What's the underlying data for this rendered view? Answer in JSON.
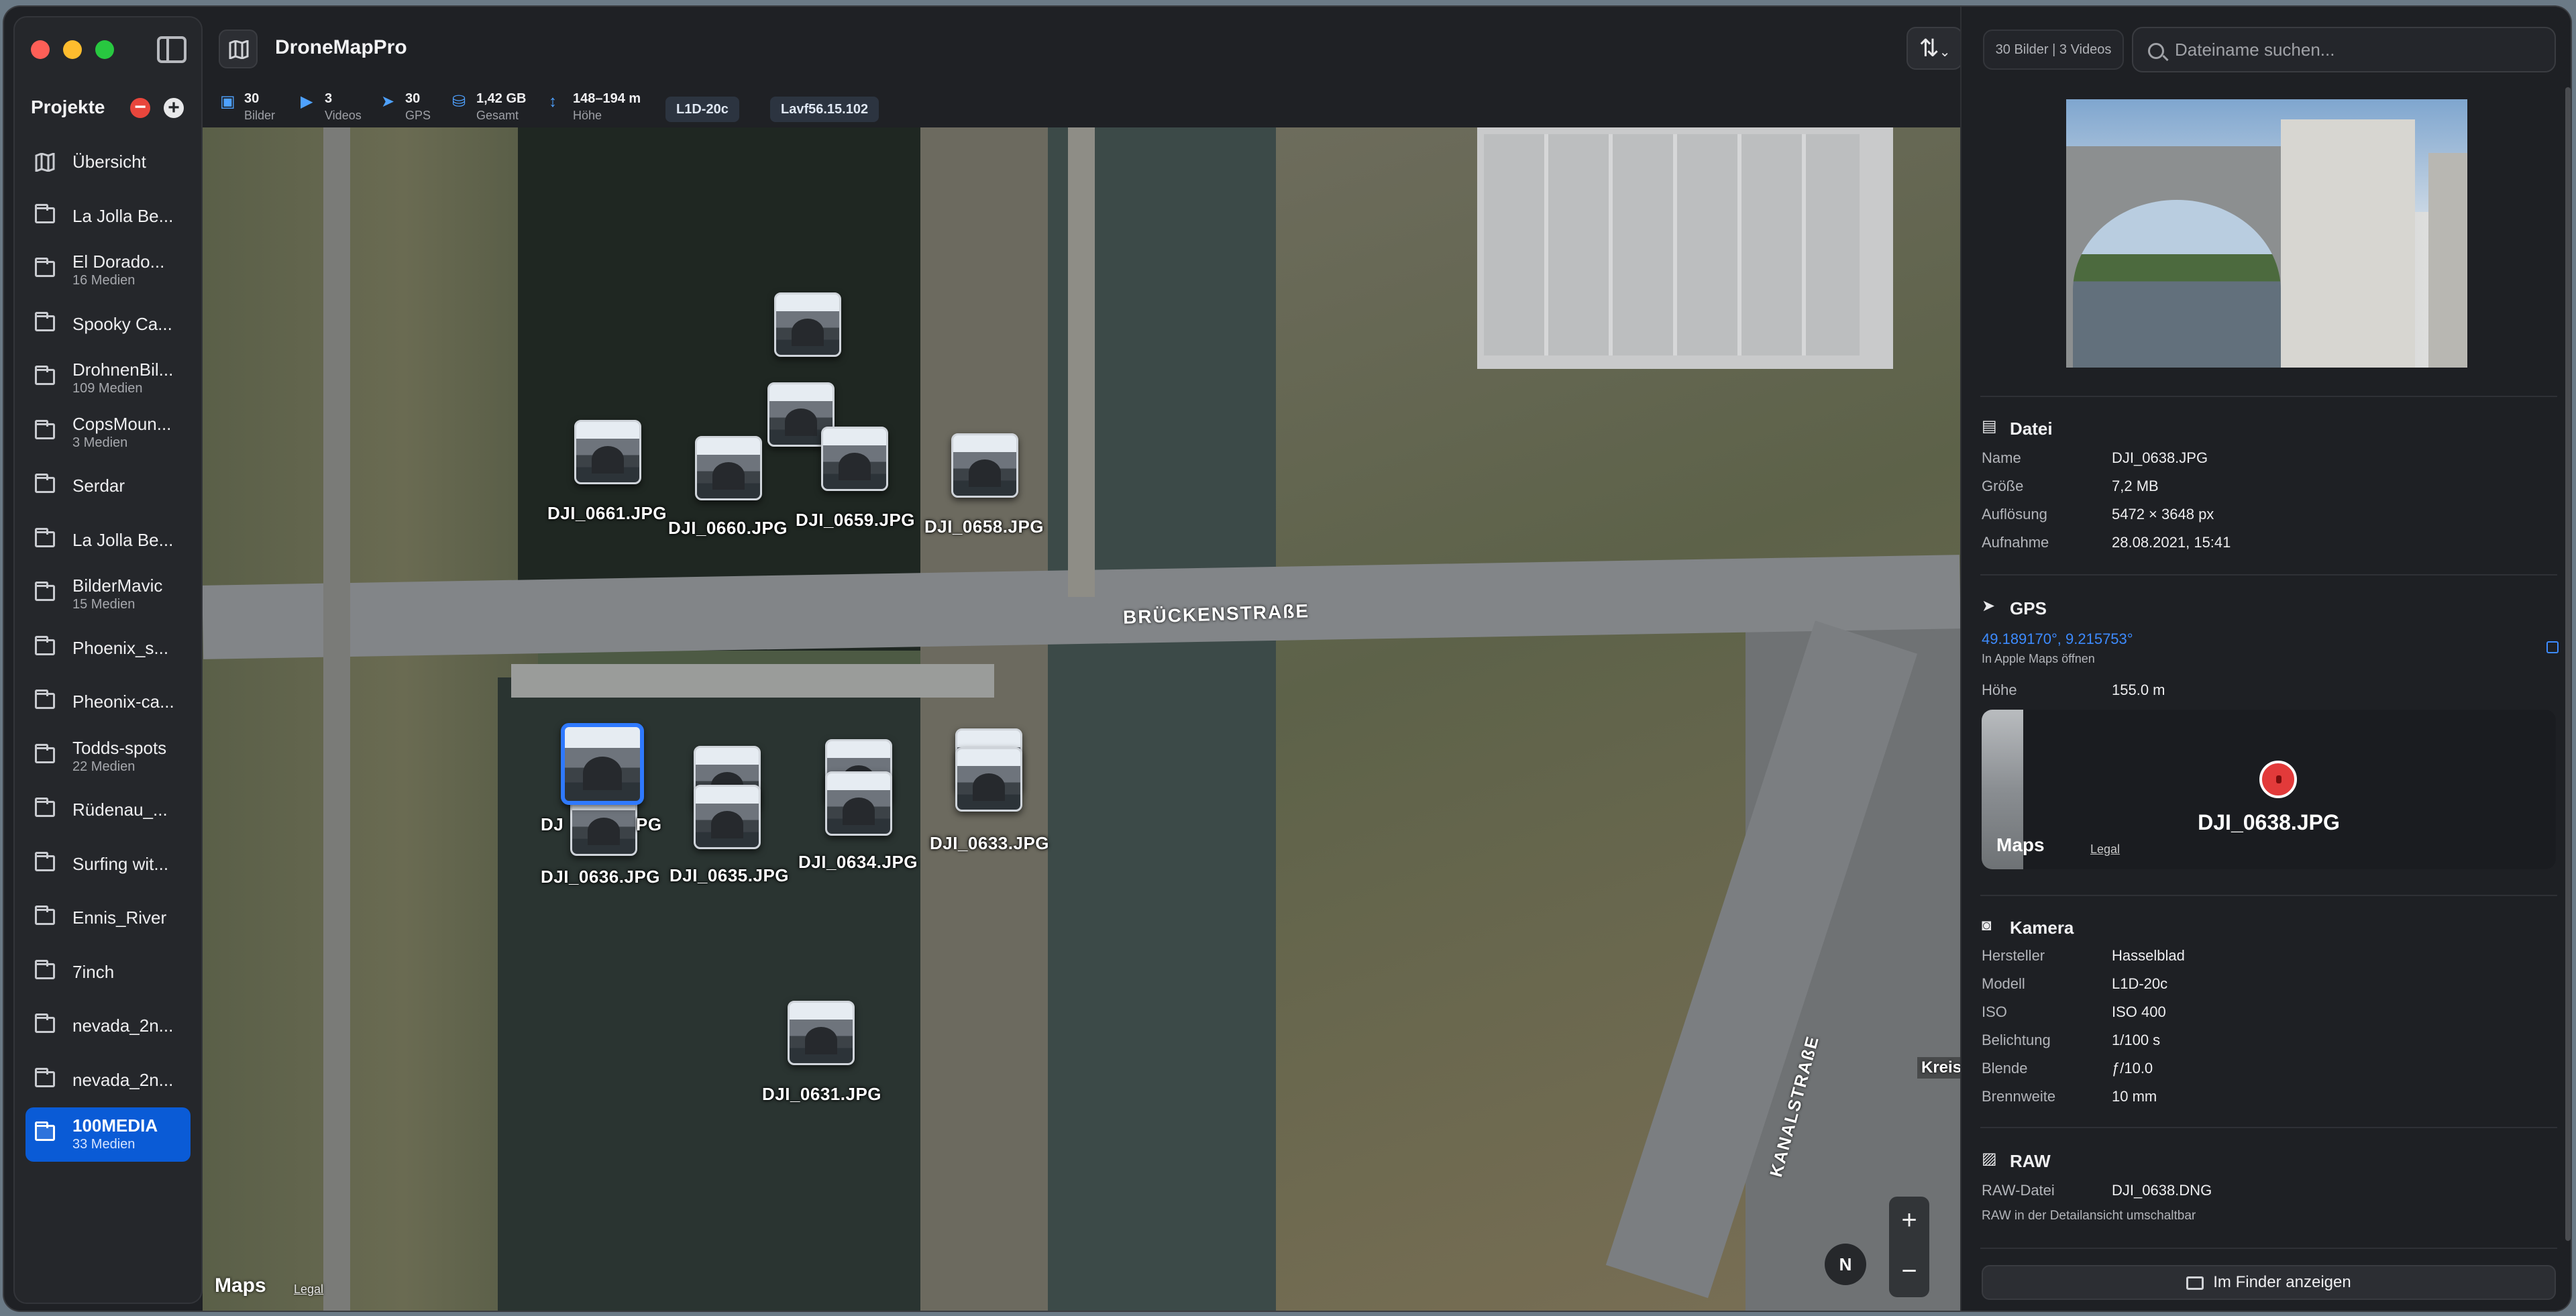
{
  "app": {
    "title": "DroneMapPro"
  },
  "sidebar": {
    "header": "Projekte",
    "items": [
      {
        "name": "Übersicht",
        "sub": "",
        "icon": "map-icon"
      },
      {
        "name": "La Jolla Be...",
        "sub": ""
      },
      {
        "name": "El Dorado...",
        "sub": "16 Medien"
      },
      {
        "name": "Spooky Ca...",
        "sub": ""
      },
      {
        "name": "DrohnenBil...",
        "sub": "109 Medien"
      },
      {
        "name": "CopsMoun...",
        "sub": "3 Medien"
      },
      {
        "name": "Serdar",
        "sub": ""
      },
      {
        "name": "La Jolla Be...",
        "sub": ""
      },
      {
        "name": "BilderMavic",
        "sub": "15 Medien"
      },
      {
        "name": "Phoenix_s...",
        "sub": ""
      },
      {
        "name": "Pheonix-ca...",
        "sub": ""
      },
      {
        "name": "Todds-spots",
        "sub": "22 Medien"
      },
      {
        "name": "Rüdenau_...",
        "sub": ""
      },
      {
        "name": "Surfing wit...",
        "sub": ""
      },
      {
        "name": "Ennis_River",
        "sub": ""
      },
      {
        "name": "7inch",
        "sub": ""
      },
      {
        "name": "nevada_2n...",
        "sub": ""
      },
      {
        "name": "nevada_2n...",
        "sub": ""
      },
      {
        "name": "100MEDIA",
        "sub": "33 Medien",
        "selected": true
      }
    ]
  },
  "stats": {
    "images": {
      "value": "30",
      "label": "Bilder"
    },
    "videos": {
      "value": "3",
      "label": "Videos"
    },
    "gps": {
      "value": "30",
      "label": "GPS"
    },
    "total": {
      "value": "1,42 GB",
      "label": "Gesamt"
    },
    "height": {
      "value": "148–194 m",
      "label": "Höhe"
    },
    "chip1": "L1D-20c",
    "chip2": "Lavf56.15.102"
  },
  "map": {
    "street1": "BRÜCKENSTRAßE",
    "street2": "KANALSTRAßE",
    "kreis": "Kreis",
    "maps_logo": " Maps",
    "legal": "Legal",
    "compass": "N",
    "zoom_in": "+",
    "zoom_out": "−",
    "selected_partial_left": "DJ",
    "selected_partial_right": "PG",
    "photos": [
      "DJI_0661.JPG",
      "DJI_0660.JPG",
      "DJI_0659.JPG",
      "DJI_0658.JPG",
      "DJI_0636.JPG",
      "DJI_0635.JPG",
      "DJI_0634.JPG",
      "DJI_0633.JPG",
      "DJI_0631.JPG"
    ]
  },
  "panel": {
    "count": "30 Bilder | 3 Videos",
    "search_placeholder": "Dateiname suchen...",
    "file": {
      "title": "Datei",
      "name_k": "Name",
      "name_v": "DJI_0638.JPG",
      "size_k": "Größe",
      "size_v": "7,2 MB",
      "res_k": "Auflösung",
      "res_v": "5472 × 3648 px",
      "date_k": "Aufnahme",
      "date_v": "28.08.2021, 15:41"
    },
    "gps": {
      "title": "GPS",
      "coords": "49.189170°, 9.215753°",
      "open": "In Apple Maps öffnen",
      "height_k": "Höhe",
      "height_v": "155.0 m",
      "mini_label": "DJI_0638.JPG",
      "mini_maps": " Maps",
      "mini_legal": "Legal"
    },
    "camera": {
      "title": "Kamera",
      "maker_k": "Hersteller",
      "maker_v": "Hasselblad",
      "model_k": "Modell",
      "model_v": "L1D-20c",
      "iso_k": "ISO",
      "iso_v": "ISO 400",
      "exp_k": "Belichtung",
      "exp_v": "1/100 s",
      "ap_k": "Blende",
      "ap_v": "ƒ/10.0",
      "focal_k": "Brennweite",
      "focal_v": "10 mm"
    },
    "raw": {
      "title": "RAW",
      "file_k": "RAW-Datei",
      "file_v": "DJI_0638.DNG",
      "note": "RAW in der Detailansicht umschaltbar"
    },
    "finder": "Im Finder anzeigen"
  }
}
